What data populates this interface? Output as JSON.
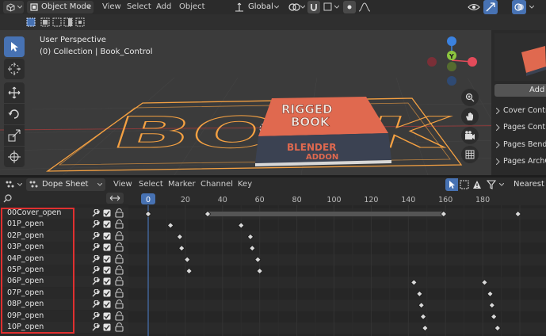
{
  "top_header": {
    "mode_label": "Object Mode",
    "menus": [
      "View",
      "Select",
      "Add",
      "Object"
    ],
    "orientation_label": "Global"
  },
  "viewport": {
    "perspective_label": "User Perspective",
    "collection_label": "(0) Collection | Book_Control",
    "gizmo_axis_label": "Y",
    "book_title_line1": "RIGGED",
    "book_title_line2": "BOOK",
    "book_subtitle_line1": "BLENDER",
    "book_subtitle_line2": "ADDON",
    "plane_text": "BOOK"
  },
  "side_panel": {
    "add_button_label": "Add",
    "items": [
      "Cover Contro",
      "Pages Contro",
      "Pages BendC",
      "Pages ArchCo"
    ]
  },
  "dope_header": {
    "editor_label": "Dope Sheet",
    "menus": [
      "View",
      "Select",
      "Marker",
      "Channel",
      "Key"
    ],
    "interpolation_label": "Nearest Fr"
  },
  "ruler": {
    "current_frame": "0",
    "ticks": [
      "20",
      "40",
      "60",
      "80",
      "100",
      "120",
      "140",
      "160",
      "180"
    ]
  },
  "channels": [
    {
      "name": "00Cover_open",
      "keys": [
        0,
        32,
        159,
        199
      ],
      "hold": [
        32,
        159
      ]
    },
    {
      "name": "01P_open",
      "keys": [
        12,
        50
      ]
    },
    {
      "name": "02P_open",
      "keys": [
        17,
        55
      ]
    },
    {
      "name": "03P_open",
      "keys": [
        18,
        56
      ]
    },
    {
      "name": "04P_open",
      "keys": [
        21,
        59
      ]
    },
    {
      "name": "05P_open",
      "keys": [
        22,
        60
      ]
    },
    {
      "name": "06P_open",
      "keys": [
        143,
        181
      ]
    },
    {
      "name": "07P_open",
      "keys": [
        146,
        184
      ]
    },
    {
      "name": "08P_open",
      "keys": [
        147,
        185
      ]
    },
    {
      "name": "09P_open",
      "keys": [
        148,
        186
      ]
    },
    {
      "name": "10P_open",
      "keys": [
        149,
        188
      ]
    }
  ],
  "colors": {
    "accent": "#4772b3",
    "highlight_box": "#e03030",
    "selection_orange": "#f5a142",
    "book_cover": "#e0694f",
    "gizmo_x": "#e34b5a",
    "gizmo_y": "#8cc63f",
    "gizmo_z": "#3b82e0"
  }
}
